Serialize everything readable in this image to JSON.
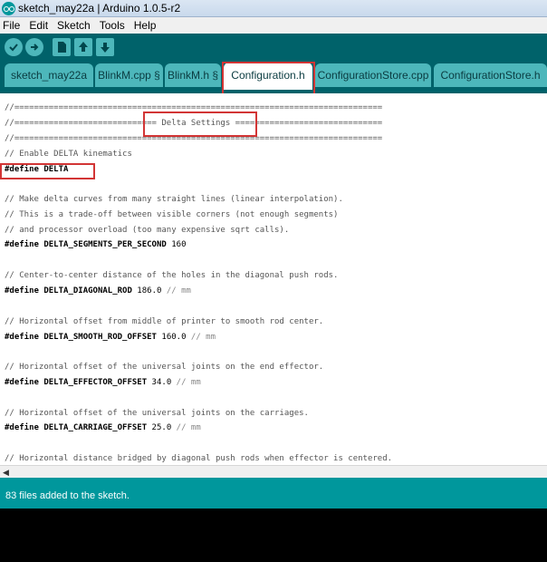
{
  "window": {
    "title": "sketch_may22a | Arduino 1.0.5-r2"
  },
  "menu": [
    "File",
    "Edit",
    "Sketch",
    "Tools",
    "Help"
  ],
  "toolbar": {
    "verify_icon": "checkmark-icon",
    "upload_icon": "arrow-right-icon",
    "new_icon": "new-file-icon",
    "open_icon": "open-arrow-up-icon",
    "save_icon": "save-arrow-down-icon"
  },
  "tabs": [
    {
      "label": "sketch_may22a"
    },
    {
      "label": "BlinkM.cpp §"
    },
    {
      "label": "BlinkM.h §"
    },
    {
      "label": "Configuration.h"
    },
    {
      "label": "ConfigurationStore.cpp"
    },
    {
      "label": "ConfigurationStore.h"
    }
  ],
  "code": {
    "l0": "//===========================================================================",
    "l1": "//============================= Delta Settings ==============================",
    "l2": "//===========================================================================",
    "l3": "// Enable DELTA kinematics",
    "l4": "#define DELTA",
    "l6": "// Make delta curves from many straight lines (linear interpolation).",
    "l7": "// This is a trade-off between visible corners (not enough segments)",
    "l8": "// and processor overload (too many expensive sqrt calls).",
    "l9a": "#define DELTA_SEGMENTS_PER_SECOND",
    "l9b": " 160",
    "l11": "// Center-to-center distance of the holes in the diagonal push rods.",
    "l12a": "#define DELTA_DIAGONAL_ROD",
    "l12b": " 186.0",
    "l12c": " // mm",
    "l14": "// Horizontal offset from middle of printer to smooth rod center.",
    "l15a": "#define DELTA_SMOOTH_ROD_OFFSET",
    "l15b": " 160.0",
    "l15c": " // mm",
    "l17": "// Horizontal offset of the universal joints on the end effector.",
    "l18a": "#define DELTA_EFFECTOR_OFFSET",
    "l18b": " 34.0",
    "l18c": " // mm",
    "l20": "// Horizontal offset of the universal joints on the carriages.",
    "l21a": "#define DELTA_CARRIAGE_OFFSET",
    "l21b": " 25.0",
    "l21c": " // mm",
    "l23": "// Horizontal distance bridged by diagonal push rods when effector is centered."
  },
  "status": {
    "message": "83 files added to the sketch."
  },
  "colors": {
    "toolbar": "#00626a",
    "tab": "#4db7bb",
    "status": "#00979c",
    "highlight": "#d23535"
  }
}
